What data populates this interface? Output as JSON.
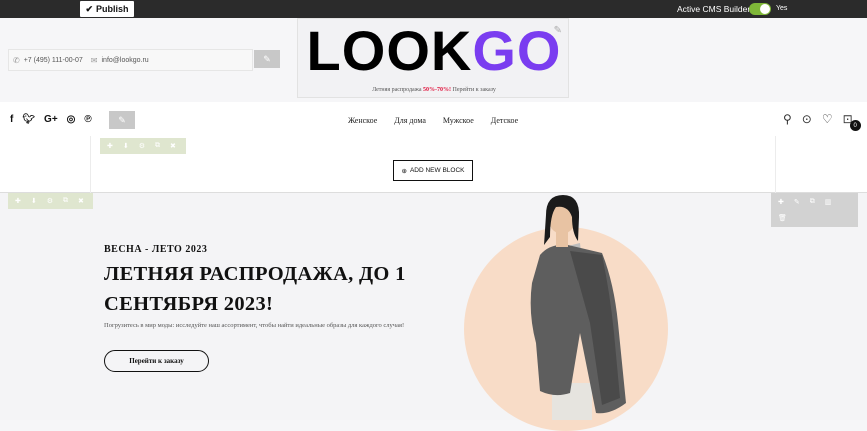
{
  "cms_bar": {
    "publish_label": "Publish",
    "builder_label": "Active CMS Builder",
    "toggle_state": "Yes",
    "toggle_color": "#7fb738"
  },
  "contacts": {
    "phone": "+7 (495) 111-00-07",
    "email": "info@lookgo.ru"
  },
  "logo": {
    "part1": "LOOK",
    "part2": "GO",
    "accent_color": "#7a3df0"
  },
  "promo": {
    "prefix": "Летняя распродажа ",
    "highlight": "50%-70%!",
    "suffix": " Перейти к заказу"
  },
  "nav": {
    "social": [
      "facebook-icon",
      "twitter-icon",
      "google-plus-icon",
      "instagram-icon",
      "pinterest-icon"
    ],
    "menu": [
      "Женское",
      "Для дома",
      "Мужское",
      "Детское"
    ],
    "cart_count": "0"
  },
  "builder": {
    "add_block_label": "ADD NEW BLOCK"
  },
  "hero": {
    "season": "ВЕСНА - ЛЕТО 2023",
    "title": "ЛЕТНЯЯ РАСПРОДАЖА, ДО 1 СЕНТЯБРЯ 2023!",
    "description": "Погрузитесь в мир моды: исследуйте наш ассортимент, чтобы найти идеальные образы для каждого случая!",
    "button_label": "Перейти к заказу",
    "circle_color": "#f8dcc7"
  }
}
